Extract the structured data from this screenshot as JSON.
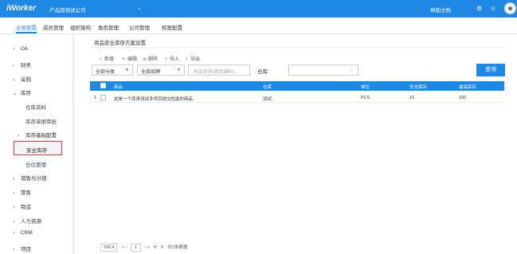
{
  "topbar": {
    "logo": "iWorker",
    "company": "产品部测试公司",
    "help": "帮助文档",
    "icons": [
      "chevron-down-icon",
      "gear-icon",
      "chat-icon",
      "avatar"
    ]
  },
  "nav": {
    "tabs": [
      "业务配置",
      "成员管理",
      "组织架构",
      "角色管理",
      "公司管理",
      "权限配置"
    ],
    "active": "业务配置"
  },
  "sidebar": {
    "items": [
      {
        "label": "OA",
        "arrow": "›"
      },
      {
        "label": "财务",
        "arrow": "›"
      },
      {
        "label": "采购",
        "arrow": "›"
      },
      {
        "label": "库存",
        "arrow": "⌄"
      },
      {
        "label": "销售与分销",
        "arrow": "›"
      },
      {
        "label": "零售",
        "arrow": "›"
      },
      {
        "label": "制造",
        "arrow": "›"
      },
      {
        "label": "人力资源",
        "arrow": "›"
      },
      {
        "label": "CRM",
        "arrow": "›"
      },
      {
        "label": "项目",
        "arrow": "›"
      }
    ],
    "inventory_sub": [
      "仓库资料",
      "库存单据审批",
      "库存基础配置",
      "安全库存",
      "仓位管理"
    ],
    "selected": "安全库存"
  },
  "panel": {
    "title": "商品安全库存方案设置",
    "toolbar": [
      "新增",
      "编辑",
      "删除",
      "导入",
      "导出"
    ],
    "filters": {
      "category": "全部分类",
      "brand": "全部品牌",
      "goods_placeholder": "商品名称/商品编码/...",
      "location_label": "仓库:",
      "query_button": "查询"
    },
    "table": {
      "headers": [
        "商品",
        "仓库",
        "单位",
        "安全库存",
        "最高库存"
      ],
      "rows": [
        {
          "index": "1",
          "goods": "这是一个库来测试多项目提交性能的商品",
          "warehouse": "测试",
          "unit": "PCS",
          "safety": "10",
          "max": "100"
        }
      ]
    },
    "pager": {
      "page_size": "100",
      "page": "1",
      "of": "0",
      "total": "共1条数据"
    }
  }
}
